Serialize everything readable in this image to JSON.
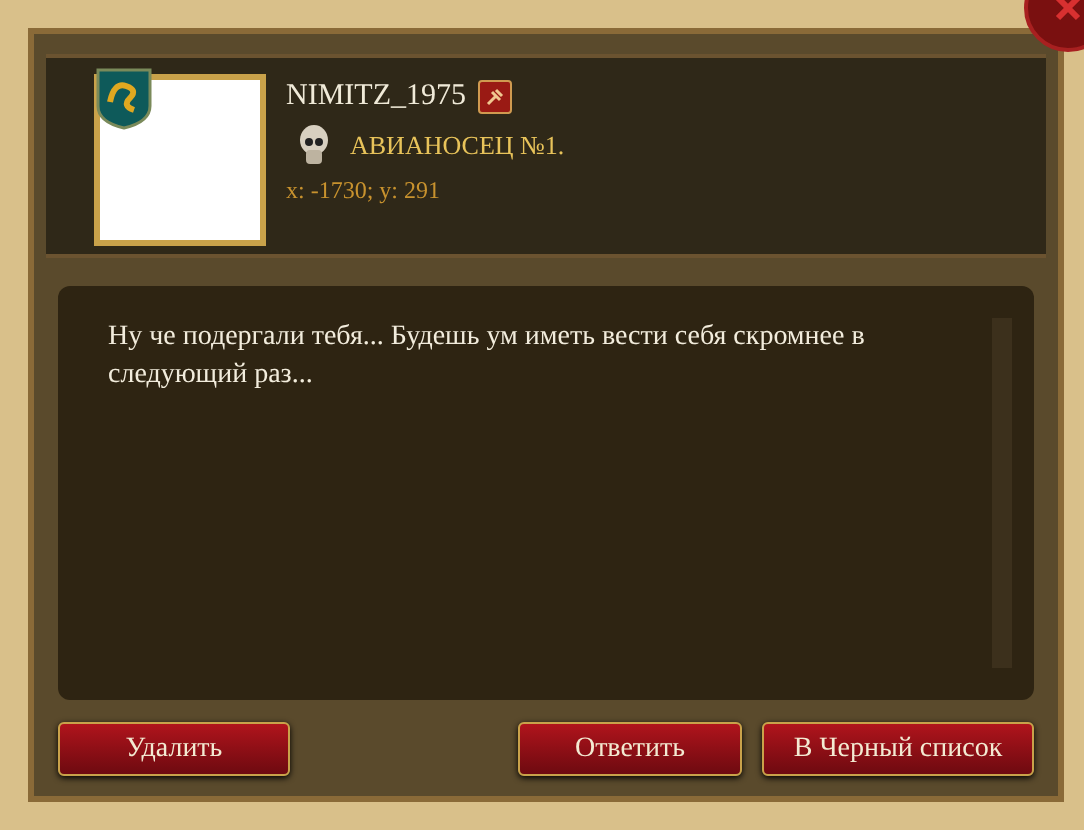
{
  "sender": {
    "name": "NIMITZ_1975",
    "title": "АВИАНОСЕЦ №1.",
    "coords": "x: -1730; y: 291"
  },
  "message": "Ну че подергали тебя... Будешь ум иметь вести себя скромнее в следующий раз...",
  "left_buttons": [
    "Удалить"
  ],
  "right_buttons": [
    "Ответить",
    "В Черный список"
  ]
}
